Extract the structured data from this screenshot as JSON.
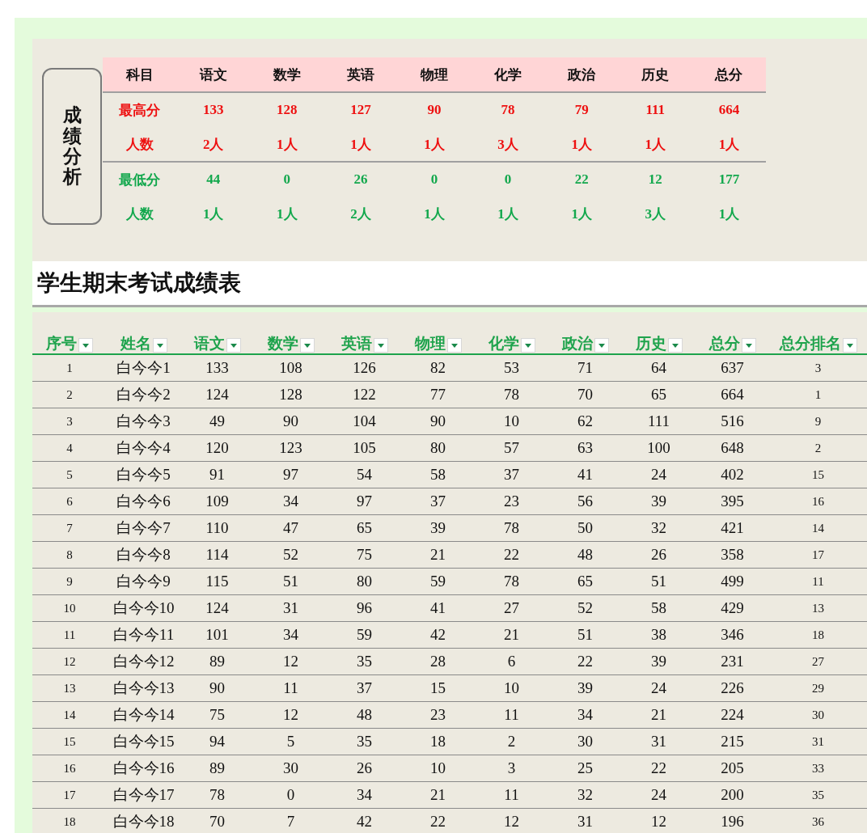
{
  "summary": {
    "side_label": "成绩分析",
    "header": [
      "科目",
      "语文",
      "数学",
      "英语",
      "物理",
      "化学",
      "政治",
      "历史",
      "总分"
    ],
    "rows": [
      {
        "kind": "high",
        "cells": [
          "最高分",
          "133",
          "128",
          "127",
          "90",
          "78",
          "79",
          "111",
          "664"
        ]
      },
      {
        "kind": "high",
        "cells": [
          "人数",
          "2人",
          "1人",
          "1人",
          "1人",
          "3人",
          "1人",
          "1人",
          "1人"
        ]
      },
      {
        "kind": "low",
        "cells": [
          "最低分",
          "44",
          "0",
          "26",
          "0",
          "0",
          "22",
          "12",
          "177"
        ]
      },
      {
        "kind": "low",
        "cells": [
          "人数",
          "1人",
          "1人",
          "2人",
          "1人",
          "1人",
          "1人",
          "3人",
          "1人"
        ]
      }
    ]
  },
  "title": "学生期末考试成绩表",
  "table": {
    "columns": [
      "序号",
      "姓名",
      "语文",
      "数学",
      "英语",
      "物理",
      "化学",
      "政治",
      "历史",
      "总分",
      "总分排名"
    ],
    "rows": [
      [
        "1",
        "白今今1",
        "133",
        "108",
        "126",
        "82",
        "53",
        "71",
        "64",
        "637",
        "3"
      ],
      [
        "2",
        "白今今2",
        "124",
        "128",
        "122",
        "77",
        "78",
        "70",
        "65",
        "664",
        "1"
      ],
      [
        "3",
        "白今今3",
        "49",
        "90",
        "104",
        "90",
        "10",
        "62",
        "111",
        "516",
        "9"
      ],
      [
        "4",
        "白今今4",
        "120",
        "123",
        "105",
        "80",
        "57",
        "63",
        "100",
        "648",
        "2"
      ],
      [
        "5",
        "白今今5",
        "91",
        "97",
        "54",
        "58",
        "37",
        "41",
        "24",
        "402",
        "15"
      ],
      [
        "6",
        "白今今6",
        "109",
        "34",
        "97",
        "37",
        "23",
        "56",
        "39",
        "395",
        "16"
      ],
      [
        "7",
        "白今今7",
        "110",
        "47",
        "65",
        "39",
        "78",
        "50",
        "32",
        "421",
        "14"
      ],
      [
        "8",
        "白今今8",
        "114",
        "52",
        "75",
        "21",
        "22",
        "48",
        "26",
        "358",
        "17"
      ],
      [
        "9",
        "白今今9",
        "115",
        "51",
        "80",
        "59",
        "78",
        "65",
        "51",
        "499",
        "11"
      ],
      [
        "10",
        "白今今10",
        "124",
        "31",
        "96",
        "41",
        "27",
        "52",
        "58",
        "429",
        "13"
      ],
      [
        "11",
        "白今今11",
        "101",
        "34",
        "59",
        "42",
        "21",
        "51",
        "38",
        "346",
        "18"
      ],
      [
        "12",
        "白今今12",
        "89",
        "12",
        "35",
        "28",
        "6",
        "22",
        "39",
        "231",
        "27"
      ],
      [
        "13",
        "白今今13",
        "90",
        "11",
        "37",
        "15",
        "10",
        "39",
        "24",
        "226",
        "29"
      ],
      [
        "14",
        "白今今14",
        "75",
        "12",
        "48",
        "23",
        "11",
        "34",
        "21",
        "224",
        "30"
      ],
      [
        "15",
        "白今今15",
        "94",
        "5",
        "35",
        "18",
        "2",
        "30",
        "31",
        "215",
        "31"
      ],
      [
        "16",
        "白今今16",
        "89",
        "30",
        "26",
        "10",
        "3",
        "25",
        "22",
        "205",
        "33"
      ],
      [
        "17",
        "白今今17",
        "78",
        "0",
        "34",
        "21",
        "11",
        "32",
        "24",
        "200",
        "35"
      ],
      [
        "18",
        "白今今18",
        "70",
        "7",
        "42",
        "22",
        "12",
        "31",
        "12",
        "196",
        "36"
      ]
    ]
  }
}
